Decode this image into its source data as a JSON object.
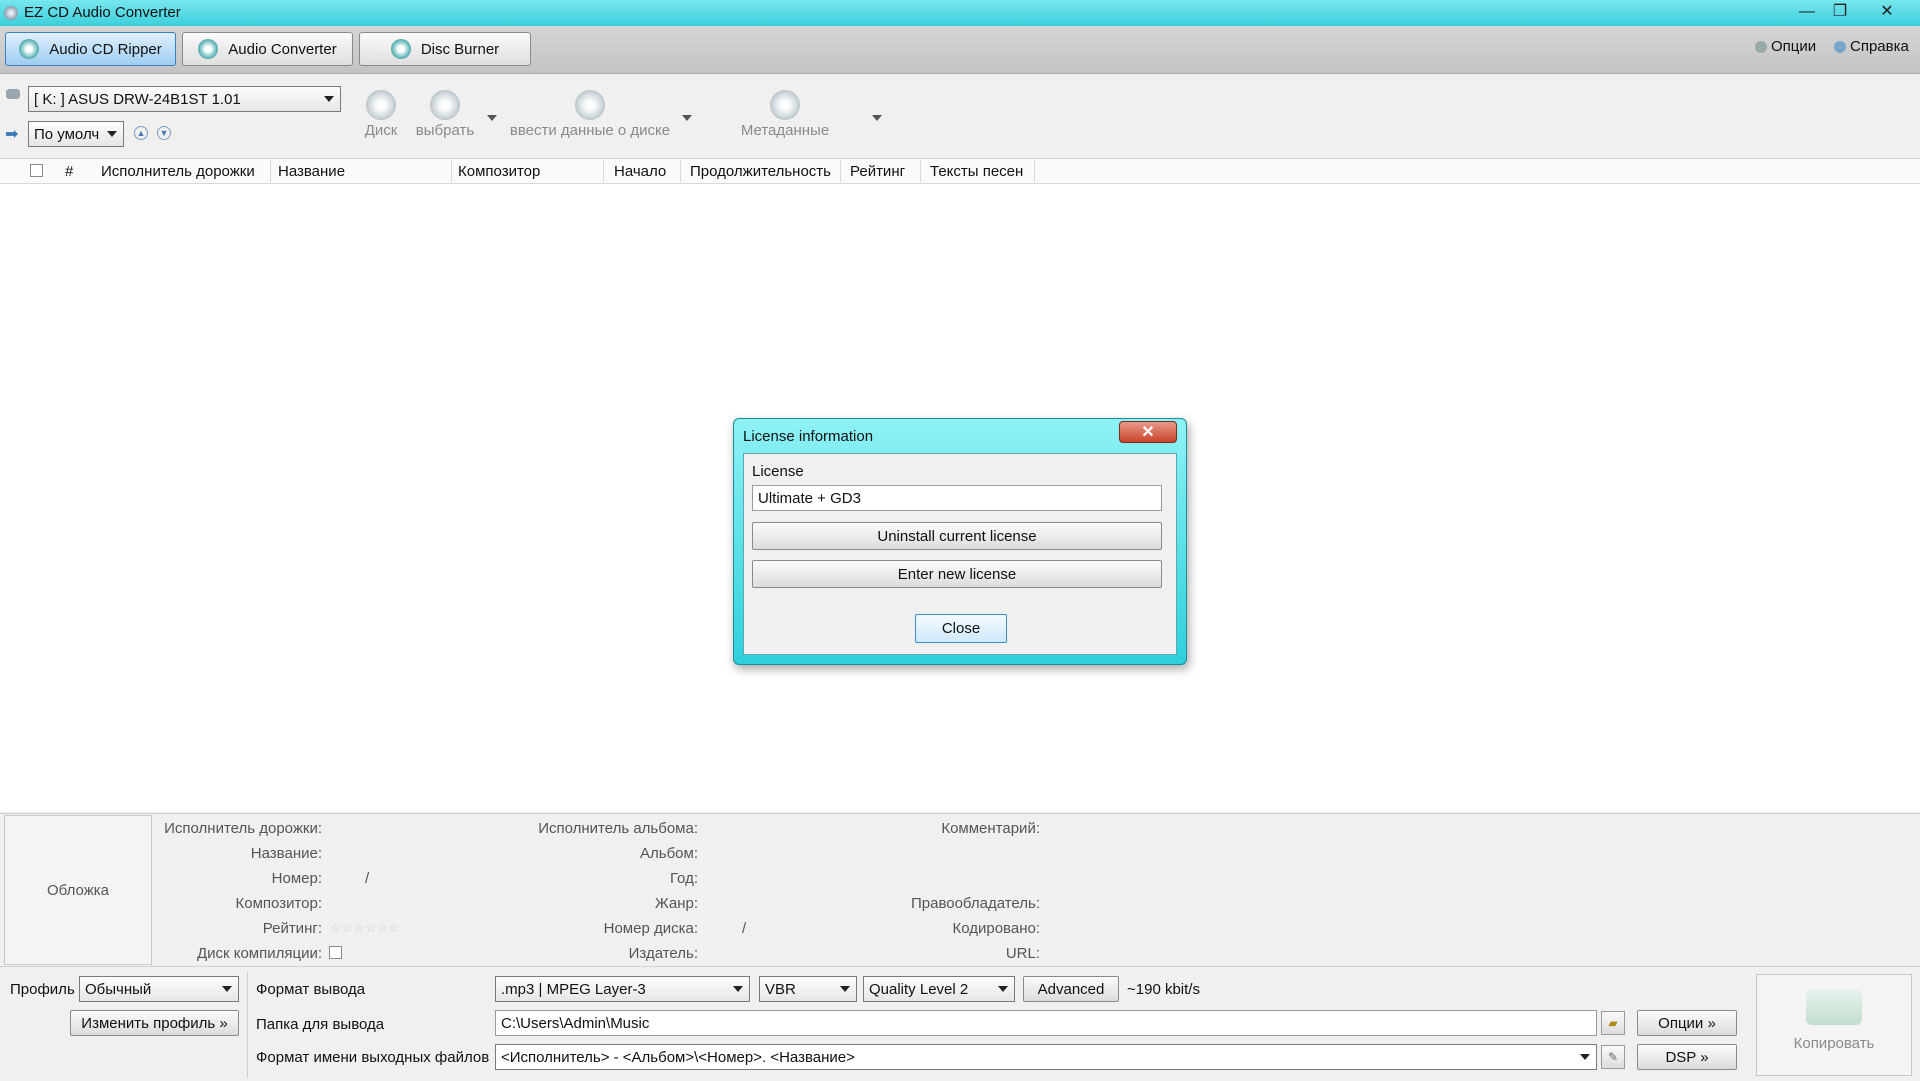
{
  "window": {
    "title": "EZ CD Audio Converter",
    "minimize": "—",
    "maximize": "❐",
    "close": "✕"
  },
  "modes": [
    {
      "label": "Audio CD Ripper"
    },
    {
      "label": "Audio Converter"
    },
    {
      "label": "Disc Burner"
    }
  ],
  "topmenu": {
    "options": "Опции",
    "help": "Справка"
  },
  "toolbar": {
    "drive": "[ K: ] ASUS DRW-24B1ST 1.01",
    "profile_small": "По умолч",
    "disc": "Диск",
    "select": "выбрать",
    "enter_disc": "ввести данные о диске",
    "metadata": "Метаданные"
  },
  "columns": [
    "#",
    "Исполнитель дорожки",
    "Название",
    "Композитор",
    "Начало",
    "Продолжительность",
    "Рейтинг",
    "Тексты песен"
  ],
  "dialog": {
    "title": "License information",
    "group_label": "License",
    "license_value": "Ultimate + GD3",
    "uninstall": "Uninstall current license",
    "enter_new": "Enter new license",
    "close": "Close",
    "close_x": "✕"
  },
  "tags": {
    "cover": "Обложка",
    "track_artist": "Исполнитель дорожки:",
    "title": "Название:",
    "number": "Номер:",
    "number_sep": "/",
    "composer": "Композитор:",
    "rating": "Рейтинг:",
    "rating_stars": "☆☆☆☆☆☆",
    "compilation": "Диск компиляции:",
    "album_artist": "Исполнитель альбома:",
    "album": "Альбом:",
    "year": "Год:",
    "genre": "Жанр:",
    "disc_number": "Номер диска:",
    "disc_sep": "/",
    "publisher": "Издатель:",
    "comment": "Комментарий:",
    "copyright": "Правообладатель:",
    "encoded": "Кодировано:",
    "url": "URL:"
  },
  "bottom": {
    "profile_label": "Профиль",
    "profile_value": "Обычный",
    "change_profile": "Изменить профиль »",
    "output_format_label": "Формат вывода",
    "format": ".mp3 | MPEG Layer-3",
    "mode": "VBR",
    "quality": "Quality Level 2",
    "advanced": "Advanced",
    "bitrate": "~190 kbit/s",
    "output_folder_label": "Папка для вывода",
    "output_folder": "C:\\Users\\Admin\\Music",
    "options": "Опции »",
    "filename_label": "Формат имени выходных файлов",
    "filename_pattern": "<Исполнитель> - <Альбом>\\<Номер>. <Название>",
    "dsp": "DSP »",
    "copy": "Копировать"
  }
}
